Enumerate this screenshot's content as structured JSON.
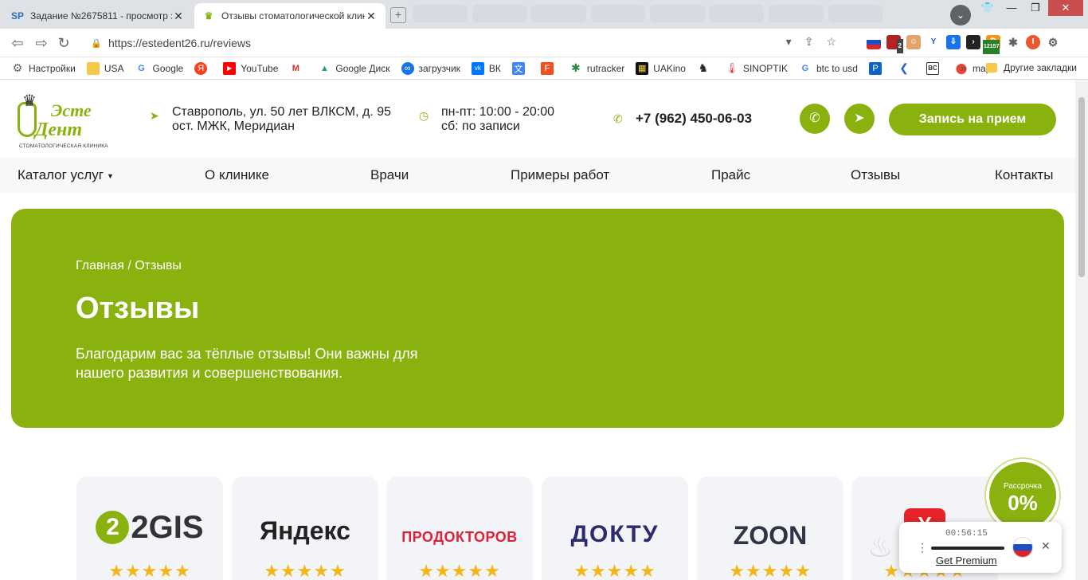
{
  "tabs": [
    {
      "title": "Задание №2675811 - просмотр з",
      "favicon": "SP",
      "active": false
    },
    {
      "title": "Отзывы стоматологической клин",
      "favicon": "tooth-icon",
      "active": true
    }
  ],
  "address": {
    "url": "https://estedent26.ru/reviews"
  },
  "extensions": {
    "badge_count": "12157",
    "ext2_badge": "2",
    "profile_letter": "I"
  },
  "bookmarks": [
    {
      "label": "Настройки",
      "icon": "gear-icon"
    },
    {
      "label": "USA",
      "icon": "folder-icon"
    },
    {
      "label": "Google",
      "icon": "google-icon"
    },
    {
      "label": "",
      "icon": "yandex-icon"
    },
    {
      "label": "YouTube",
      "icon": "youtube-icon"
    },
    {
      "label": "",
      "icon": "gmail-icon"
    },
    {
      "label": "Google Диск",
      "icon": "drive-icon"
    },
    {
      "label": "загрузчик",
      "icon": "infinity-icon"
    },
    {
      "label": "ВК",
      "icon": "vk-icon"
    },
    {
      "label": "",
      "icon": "translate-icon"
    },
    {
      "label": "",
      "icon": "f-icon"
    },
    {
      "label": "rutracker",
      "icon": "star-icon"
    },
    {
      "label": "UAKino",
      "icon": "film-icon"
    },
    {
      "label": "",
      "icon": "chess-icon"
    },
    {
      "label": "SINOPTIK",
      "icon": "thermometer-icon"
    },
    {
      "label": "btc to usd",
      "icon": "google-icon"
    },
    {
      "label": "",
      "icon": "p-icon"
    },
    {
      "label": "",
      "icon": "arrow-icon"
    },
    {
      "label": "",
      "icon": "bc-icon"
    },
    {
      "label": "maps",
      "icon": "maps-icon"
    }
  ],
  "bookmarks_more": "»",
  "bookmarks_other": "Другие закладки",
  "site": {
    "logo_text1": "Эсте",
    "logo_text2": "Дент",
    "logo_sub": "СТОМАТОЛОГИЧЕСКАЯ КЛИНИКА",
    "address_line1": "Ставрополь, ул. 50 лет ВЛКСМ, д. 95",
    "address_line2": "ост. МЖК, Меридиан",
    "hours_line1": "пн-пт: 10:00 - 20:00",
    "hours_line2": "сб: по записи",
    "phone": "+7 (962) 450-06-03",
    "cta": "Запись на прием",
    "accent": "#8ab20f"
  },
  "menu": [
    "Каталог услуг",
    "О клинике",
    "Врачи",
    "Примеры работ",
    "Прайс",
    "Отзывы",
    "Контакты"
  ],
  "hero": {
    "crumbs": "Главная / Отзывы",
    "title": "Отзывы",
    "subtitle": "Благодарим вас за тёплые отзывы! Они важны для нашего развития и совершенствования."
  },
  "review_sites": [
    {
      "name": "2GIS",
      "rating": 5
    },
    {
      "name": "Яндекс",
      "rating": 5
    },
    {
      "name": "ПРОДОКТОРОВ",
      "rating": 5
    },
    {
      "name": "ДОКТУ",
      "rating": 5
    },
    {
      "name": "ZOON",
      "rating": 5
    },
    {
      "name": "",
      "rating": 5
    }
  ],
  "stars": "★★★★★",
  "installment": {
    "label": "Рассрочка",
    "value": "0%"
  },
  "media_widget": {
    "time": "00:56:15",
    "premium": "Get Premium"
  }
}
